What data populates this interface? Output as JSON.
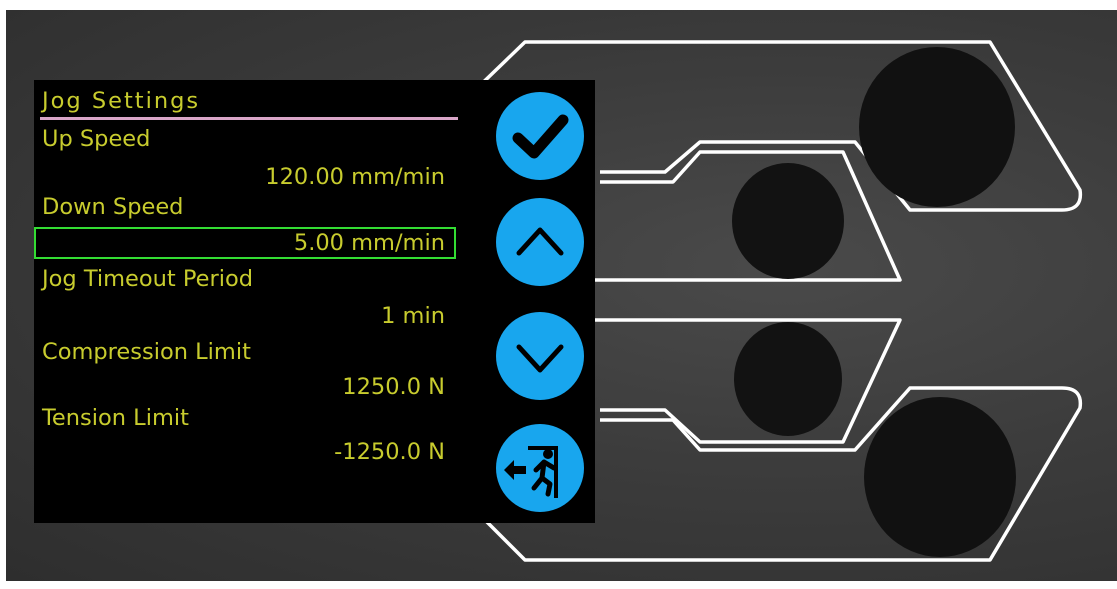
{
  "screen": {
    "title": "Jog Settings",
    "settings": [
      {
        "label": "Up Speed",
        "value": "120.00 mm/min"
      },
      {
        "label": "Down Speed",
        "value": "5.00 mm/min",
        "selected": true
      },
      {
        "label": "Jog Timeout Period",
        "value": "1 min"
      },
      {
        "label": "Compression Limit",
        "value": "1250.0 N"
      },
      {
        "label": "Tension Limit",
        "value": "-1250.0 N"
      }
    ]
  },
  "buttons": [
    {
      "icon": "checkmark-icon",
      "action": "confirm"
    },
    {
      "icon": "chevron-up-icon",
      "action": "up"
    },
    {
      "icon": "chevron-down-icon",
      "action": "down"
    },
    {
      "icon": "exit-icon",
      "action": "exit"
    }
  ],
  "colors": {
    "lcd_text": "#c8cc2e",
    "title_rule": "#d9a6c8",
    "selection_border": "#33dd33",
    "button_blue": "#18a6ee",
    "screen_bg": "#000000",
    "panel_bg": "#3c3c3c"
  }
}
